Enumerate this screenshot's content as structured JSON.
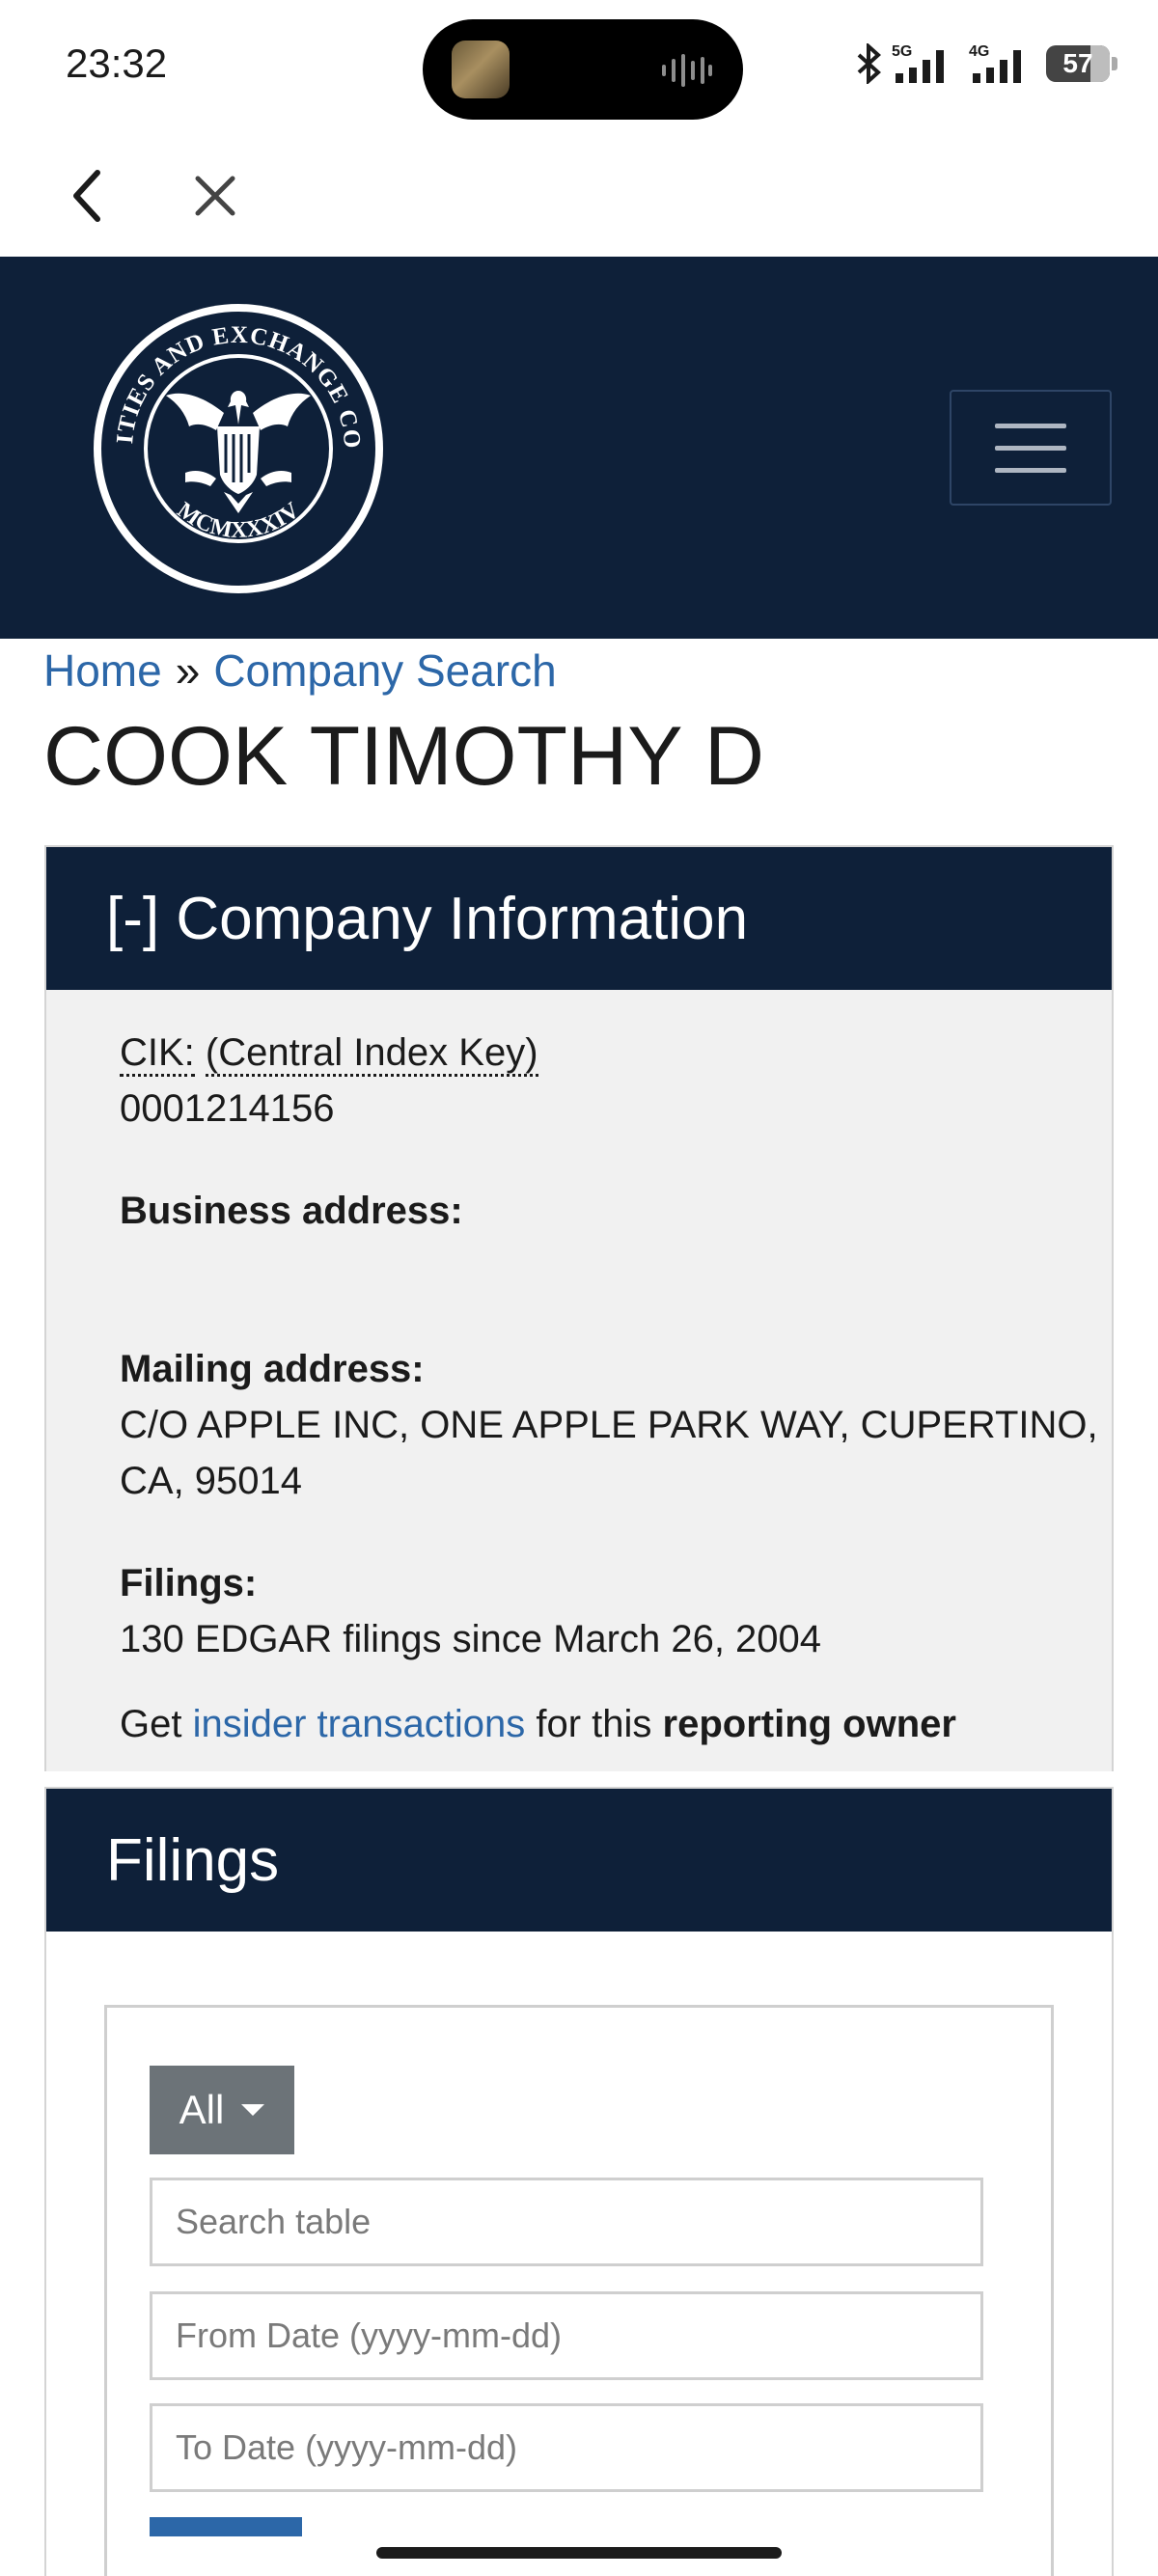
{
  "status_bar": {
    "time": "23:32",
    "battery": "57",
    "net1": "5G",
    "net2": "4G"
  },
  "browser_nav": {
    "back_icon": "chevron-left-icon",
    "close_icon": "close-icon"
  },
  "header": {
    "logo_alt": "U.S. Securities and Exchange Commission seal",
    "seal_top_text": "U.S. SECURITIES AND EXCHANGE COMMISSION",
    "seal_bottom_text": "MCMXXXIV",
    "menu_icon": "hamburger-icon"
  },
  "breadcrumb": {
    "home": "Home",
    "separator": "»",
    "company_search": "Company Search"
  },
  "page": {
    "title": "COOK TIMOTHY D"
  },
  "company_info": {
    "header": "[-] Company Information",
    "cik_label": "CIK:",
    "cik_expansion": "(Central Index Key)",
    "cik_value": "0001214156",
    "business_address_label": "Business address:",
    "mailing_address_label": "Mailing address:",
    "mailing_address_line1": "C/O APPLE INC, ONE APPLE PARK WAY, CUPERTINO,",
    "mailing_address_line2": "CA, 95014",
    "filings_label": "Filings:",
    "filings_value": "130 EDGAR filings since March 26, 2004",
    "insider_prefix": "Get",
    "insider_link": "insider transactions",
    "insider_middle": "for this",
    "insider_bold": "reporting owner"
  },
  "filings": {
    "header": "Filings",
    "filter_selected": "All",
    "search_placeholder": "Search table",
    "from_placeholder": "From Date (yyyy-mm-dd)",
    "to_placeholder": "To Date (yyyy-mm-dd)"
  },
  "colors": {
    "navy": "#0e2039",
    "link": "#2c67a8",
    "panel_bg": "#f1f1f1",
    "button_gray": "#6c7378"
  }
}
